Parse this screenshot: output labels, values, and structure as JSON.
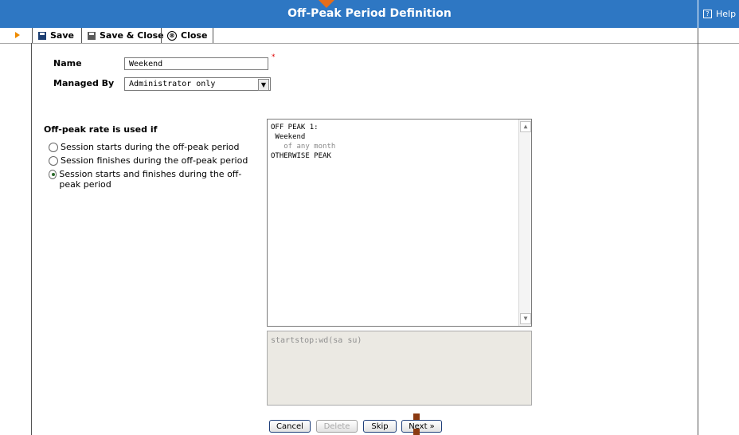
{
  "window": {
    "title": "Off-Peak Period Definition",
    "help_label": "Help",
    "help_icon": "?"
  },
  "toolbar": {
    "save_label": "Save",
    "save_close_label": "Save & Close",
    "close_label": "Close",
    "close_icon": "⊗"
  },
  "form": {
    "name_label": "Name",
    "name_value": "Weekend",
    "required_mark": "*",
    "managed_by_label": "Managed By",
    "managed_by_value": "Administrator only",
    "offpeak_label": "Off-peak rate is used if",
    "options": [
      {
        "label": "Session starts during the off-peak period",
        "selected": false
      },
      {
        "label": "Session finishes during the off-peak period",
        "selected": false
      },
      {
        "label": "Session starts and finishes during the off-peak period",
        "selected": true
      }
    ]
  },
  "preview": {
    "lines": [
      "OFF PEAK 1:",
      " Weekend",
      "   of any month",
      "OTHERWISE PEAK"
    ]
  },
  "rule": {
    "value": "startstop:wd(sa su)"
  },
  "buttons": {
    "cancel": "Cancel",
    "delete": "Delete",
    "skip": "Skip",
    "next": "Next »"
  },
  "colors": {
    "titlebar": "#2e77c3",
    "accent_arrow": "#e56d1a"
  },
  "icons": {
    "dropdown": "▼",
    "scroll_up": "▲",
    "scroll_down": "▼"
  }
}
